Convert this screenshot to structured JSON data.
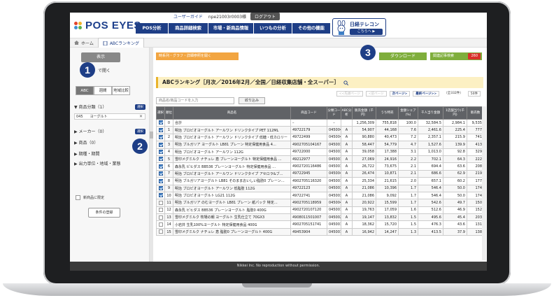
{
  "header": {
    "logo": "POS EYES",
    "user_label": "ユーザーガイド",
    "user_id": "npe21003r0003様",
    "logout": "ログアウト",
    "nav": [
      "POS分析",
      "商品詳細検索",
      "市場・新商品情報",
      "いつもの分析",
      "その他の機能"
    ],
    "telecon_title": "日経テレコン",
    "telecon_link": "こちらへ ▶"
  },
  "breadcrumb": {
    "home": "ホーム",
    "current": "ABCランキング"
  },
  "left": {
    "show_button": "表示",
    "open_link": "で開く",
    "segments": [
      "ABC",
      "週間",
      "地域比較"
    ],
    "conditions": [
      {
        "label": "▼ 商品分類（1）",
        "btn": "選択"
      },
      {
        "label": "▶ メーカー（0）",
        "btn": "選択"
      },
      {
        "label": "▶ 商品（0）",
        "btn": "選択"
      },
      {
        "label": "▶ 期種・期間",
        "btn": ""
      },
      {
        "label": "▶ 出力単位・地域・業態",
        "btn": ""
      }
    ],
    "category_code": "045",
    "category_name": "ヨーグルト",
    "category_clear": "✕",
    "new_only": "新商品に限定",
    "register_button": "条件の登録"
  },
  "badges": [
    "1",
    "2",
    "3"
  ],
  "main": {
    "options_bar": "時系列・グラフ・詳細参照を開く",
    "download": "ダウンロード",
    "kiji": "関連記事検索",
    "kiji_count": "260",
    "title": "ABCランキング［月次／2016年2月／全国／日経収集店舗・全スーパー］",
    "search_placeholder": "商品名/商品コードを入力",
    "search_button": "絞り込み",
    "pager": [
      "<<先頭ページ",
      "<前ページ",
      "次ページ>",
      "最終ページ>>",
      "（全332件）",
      "50件"
    ],
    "columns": [
      "選択",
      "順位",
      "商品名",
      "商品コード",
      "分類コード",
      "ABC分析",
      "販売金額（千円）",
      "うち特売",
      "金額シェア(%)",
      "千人当り金額",
      "1店舗当り(千円)",
      "販売数"
    ]
  },
  "rows": [
    [
      "on",
      "0",
      "合計",
      "–",
      "–",
      "",
      "1,256,309",
      "755,818",
      "100.0",
      "32,584.5",
      "2,984.1",
      "9,535"
    ],
    [
      "on",
      "1",
      "明治 ブロビオヨーグルト アールワン ドリンクタイプ PET 112ML",
      "49722179",
      "045004",
      "A",
      "54,907",
      "44,168",
      "7.6",
      "2,461.6",
      "225.4",
      "777"
    ],
    [
      "on",
      "2",
      "明治 ブロビオヨーグルト アールワン ドリンクタイプ 低糖・低カロリー",
      "49722499",
      "045004",
      "A",
      "90,880",
      "40,473",
      "7.2",
      "2,357.1",
      "215.9",
      "741"
    ],
    [
      "on",
      "3",
      "明治 ブルガリア ヨーグルト LB81 プレーン 特定保健用食品 4…",
      "4902705104167",
      "045001",
      "A",
      "58,447",
      "54,779",
      "4.7",
      "1,527.6",
      "139.9",
      "413"
    ],
    [
      "on",
      "4",
      "明治 ブロビオヨーグルト アールワン 112G",
      "49722000",
      "045003",
      "A",
      "39,058",
      "17,388",
      "3.1",
      "1,013.0",
      "92.8",
      "329"
    ],
    [
      "on",
      "5",
      "雪印メグミルク ナチュレ 恵 ブレーンヨーグルト 特定保健用食品 …",
      "49212977",
      "045001",
      "A",
      "27,069",
      "24,916",
      "2.2",
      "702.1",
      "64.3",
      "222"
    ],
    [
      "on",
      "6",
      "森永乳 ビヒダス BB536 プレーンヨーグルト 特定保健用食品 …",
      "4902720116486",
      "045001",
      "A",
      "26,722",
      "73,675",
      "2.1",
      "694.4",
      "63.6",
      "208"
    ],
    [
      "on",
      "7",
      "明治 ブロビオヨーグルト アールワン ドリンクタイプ アセロラ&ブ…",
      "49722945",
      "045004",
      "A",
      "26,474",
      "10,871",
      "2.1",
      "686.6",
      "62.9",
      "219"
    ],
    [
      "on",
      "8",
      "明治 ブルガリアヨーグルト LB81 そのままおいしい脂肪0 プレーン…",
      "4902705116320",
      "045001",
      "A",
      "25,334",
      "21,615",
      "2.0",
      "657.1",
      "60.2",
      "177"
    ],
    [
      "on",
      "9",
      "明治 ブロビオヨーグルト アールワン 低脂肪 112G",
      "49722123",
      "045003",
      "A",
      "21,086",
      "10,396",
      "1.7",
      "546.4",
      "50.0",
      "174"
    ],
    [
      "on",
      "10",
      "明治 ブロビオヨーグルト LG21 112G",
      "49722741",
      "045003",
      "A",
      "21,086",
      "9,092",
      "1.7",
      "546.4",
      "50.0",
      "174"
    ],
    [
      "",
      "11",
      "明治 ブルガリア のむヨーグルト LB81 プレーン 紙パック 特定…",
      "4902705118959",
      "045004",
      "A",
      "20,922",
      "15,599",
      "1.7",
      "542.6",
      "49.7",
      "150"
    ],
    [
      "",
      "12",
      "森永乳 ビヒダス BB536 プレーンヨーグルト 脂肪0 400G",
      "4902720107120",
      "045001",
      "A",
      "19,763",
      "17,059",
      "1.6",
      "512.6",
      "46.9",
      "152"
    ],
    [
      "",
      "13",
      "雪印メグミルク 牧場の朝 ヨーグルト 生乳仕立て 70GX3",
      "4908011501007",
      "045002",
      "A",
      "19,147",
      "13,832",
      "1.5",
      "495.6",
      "45.4",
      "203"
    ],
    [
      "",
      "14",
      "小岩井 生乳100%ヨーグルト 特定保健用食品 400G",
      "4902705151741",
      "045001",
      "A",
      "18,362",
      "15,720",
      "1.5",
      "476.3",
      "43.6",
      "131"
    ],
    [
      "",
      "15",
      "雪印メグミルク ナチュレ 恵 脂肪0 プレーンヨーグルト 400G",
      "49453904",
      "045001",
      "A",
      "16,942",
      "14,247",
      "1.3",
      "413.5",
      "37.9",
      "138"
    ]
  ],
  "footer": "Nikkei Inc. No reproduction without permission."
}
